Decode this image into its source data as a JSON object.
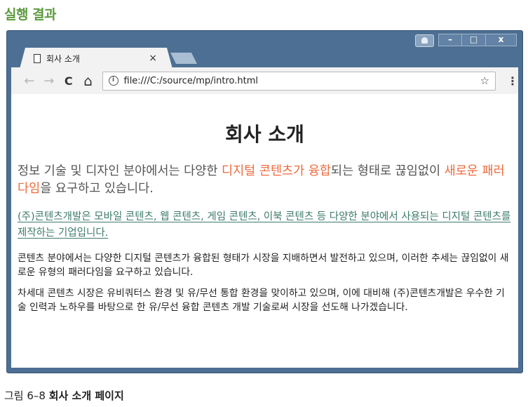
{
  "section_title": "실행 결과",
  "window": {
    "controls": {
      "minimize": "–",
      "maximize": "□",
      "close": "x"
    }
  },
  "tab": {
    "title": "회사 소개",
    "close": "×"
  },
  "toolbar": {
    "back": "←",
    "forward": "→",
    "reload": "C",
    "home": "⌂",
    "info": "i",
    "url": "file:///C:/source/mp/intro.html",
    "star": "☆",
    "menu": "⋮"
  },
  "page": {
    "heading": "회사 소개",
    "lead": {
      "part1": "정보 기술 및 디자인 분야에서는 다양한 ",
      "highlight1": "디지털 콘텐츠가 융합",
      "part2": "되는 형태로 끊임없이 ",
      "highlight2": "새로운 패러다임",
      "part3": "을 요구하고 있습니다."
    },
    "link_text": "(주)콘텐츠개발은 모바일 콘텐츠, 웹 콘텐츠, 게임 콘텐츠, 이북 콘텐츠 등 다양한 분야에서 사용되는 디지털 콘텐츠를 제작하는 기업입니다.",
    "para1": "콘텐츠 분야에서는 다양한 디지털 콘텐츠가 융합된 형태가 시장을 지배하면서 발전하고 있으며, 이러한 추세는 끊임없이 새로운 유형의 패러다임을 요구하고 있습니다.",
    "para2": "차세대 콘텐츠 시장은 유비쿼터스 환경 및 유/무선 통합 환경을 맞이하고 있으며, 이에 대비해 (주)콘텐츠개발은 우수한 기술 인력과 노하우를 바탕으로 한 유/무선 융합 콘텐츠 개발 기술로써 시장을 선도해 나가겠습니다."
  },
  "caption": {
    "number": "그림 6–8 ",
    "title": "회사 소개 페이지"
  },
  "colors": {
    "section_title": "#5b9a3e",
    "highlight": "#ee6a3c",
    "link": "#3c7a6a",
    "window_frame": "#4d6f93"
  }
}
